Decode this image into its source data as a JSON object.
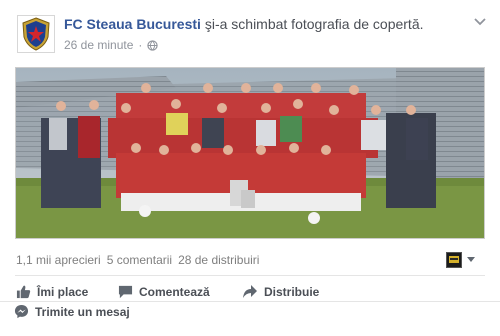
{
  "post": {
    "page_name": "FC Steaua Bucuresti",
    "action_text": "şi-a schimbat fotografia de copertă.",
    "timestamp": "26 de minute",
    "privacy_icon": "globe-icon"
  },
  "stats": {
    "likes": "1,1 mii aprecieri",
    "comments": "5 comentarii",
    "shares": "28 de distribuiri"
  },
  "actions": {
    "like": "Îmi place",
    "comment": "Comentează",
    "share": "Distribuie",
    "send": "Trimite un mesaj"
  },
  "colors": {
    "link": "#365899",
    "secondary_text": "#90949c",
    "action_text": "#4b4f56",
    "divider": "#e5e5e5"
  }
}
